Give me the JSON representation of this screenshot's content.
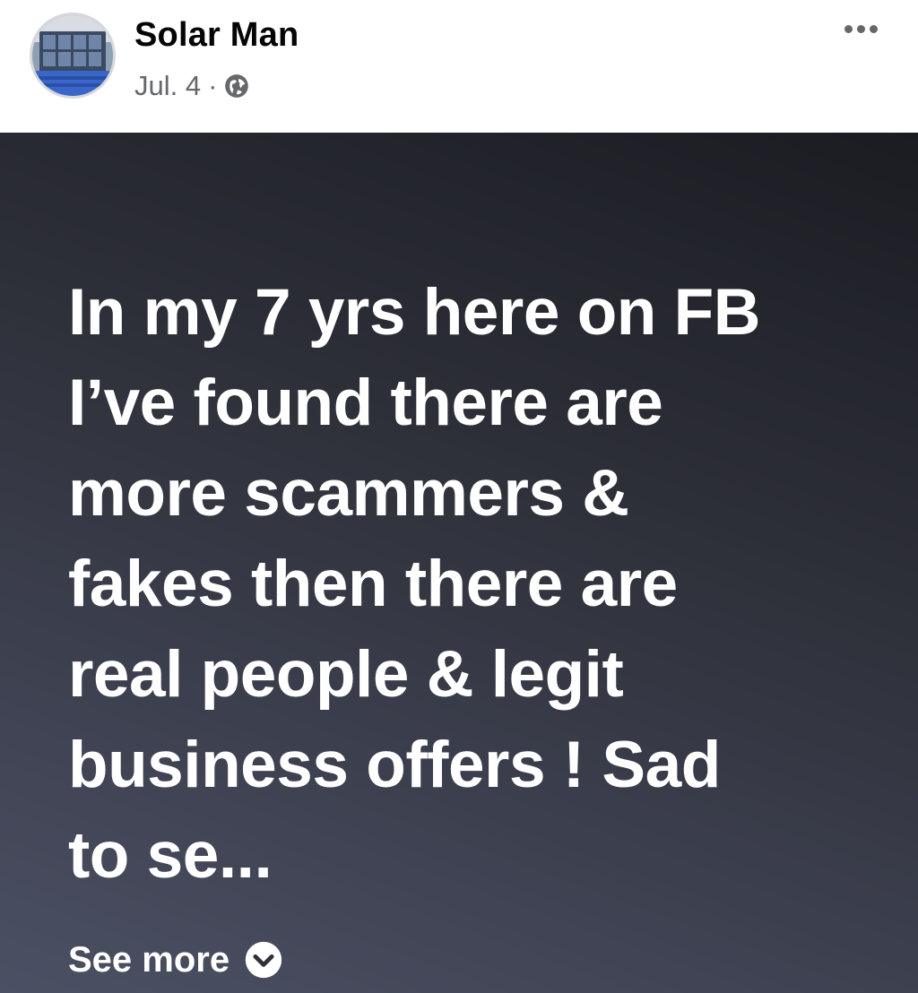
{
  "post": {
    "author": "Solar Man",
    "date": "Jul. 4",
    "separator": "·",
    "privacy_icon": "globe-icon",
    "more_icon": "more-horizontal-icon",
    "body_text": "In my 7 yrs here on FB\nI’ve found there are\nmore scammers &\nfakes then there are\nreal people & legit\nbusiness offers !   Sad\nto se...",
    "see_more_label": "See more",
    "see_more_icon": "chevron-down-icon"
  },
  "colors": {
    "name_text": "#050505",
    "meta_text": "#65676b",
    "body_bg_dark": "#1b1c22",
    "body_bg_light": "#4b5064",
    "body_text": "#ffffff"
  }
}
